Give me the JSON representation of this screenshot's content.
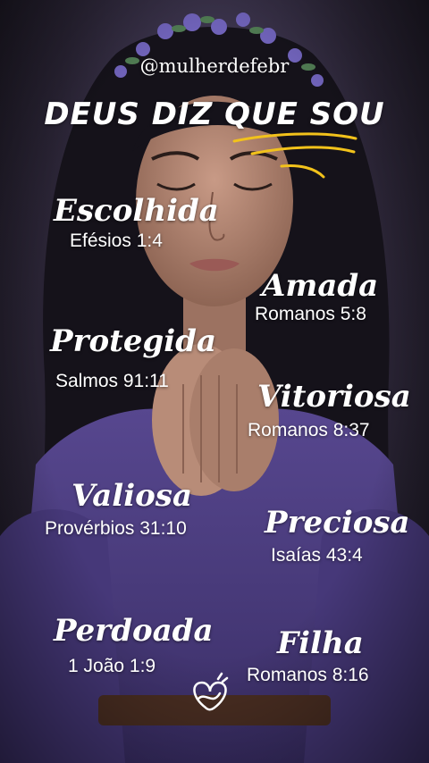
{
  "handle": "@mulherdefebr",
  "headline": "DEUS DIZ QUE SOU",
  "colors": {
    "text": "#ffffff",
    "underline_accent": "#f2c21b",
    "dress": "#4f3f86",
    "background": "#2a2435"
  },
  "icons": [
    "flower-crown",
    "heart-doodle-icon"
  ],
  "attributes": [
    {
      "word": "Escolhida",
      "reference": "Efésios 1:4"
    },
    {
      "word": "Amada",
      "reference": "Romanos 5:8"
    },
    {
      "word": "Protegida",
      "reference": "Salmos 91:11"
    },
    {
      "word": "Vitoriosa",
      "reference": "Romanos 8:37"
    },
    {
      "word": "Valiosa",
      "reference": "Provérbios 31:10"
    },
    {
      "word": "Preciosa",
      "reference": "Isaías 43:4"
    },
    {
      "word": "Perdoada",
      "reference": "1 João 1:9"
    },
    {
      "word": "Filha",
      "reference": "Romanos 8:16"
    }
  ]
}
